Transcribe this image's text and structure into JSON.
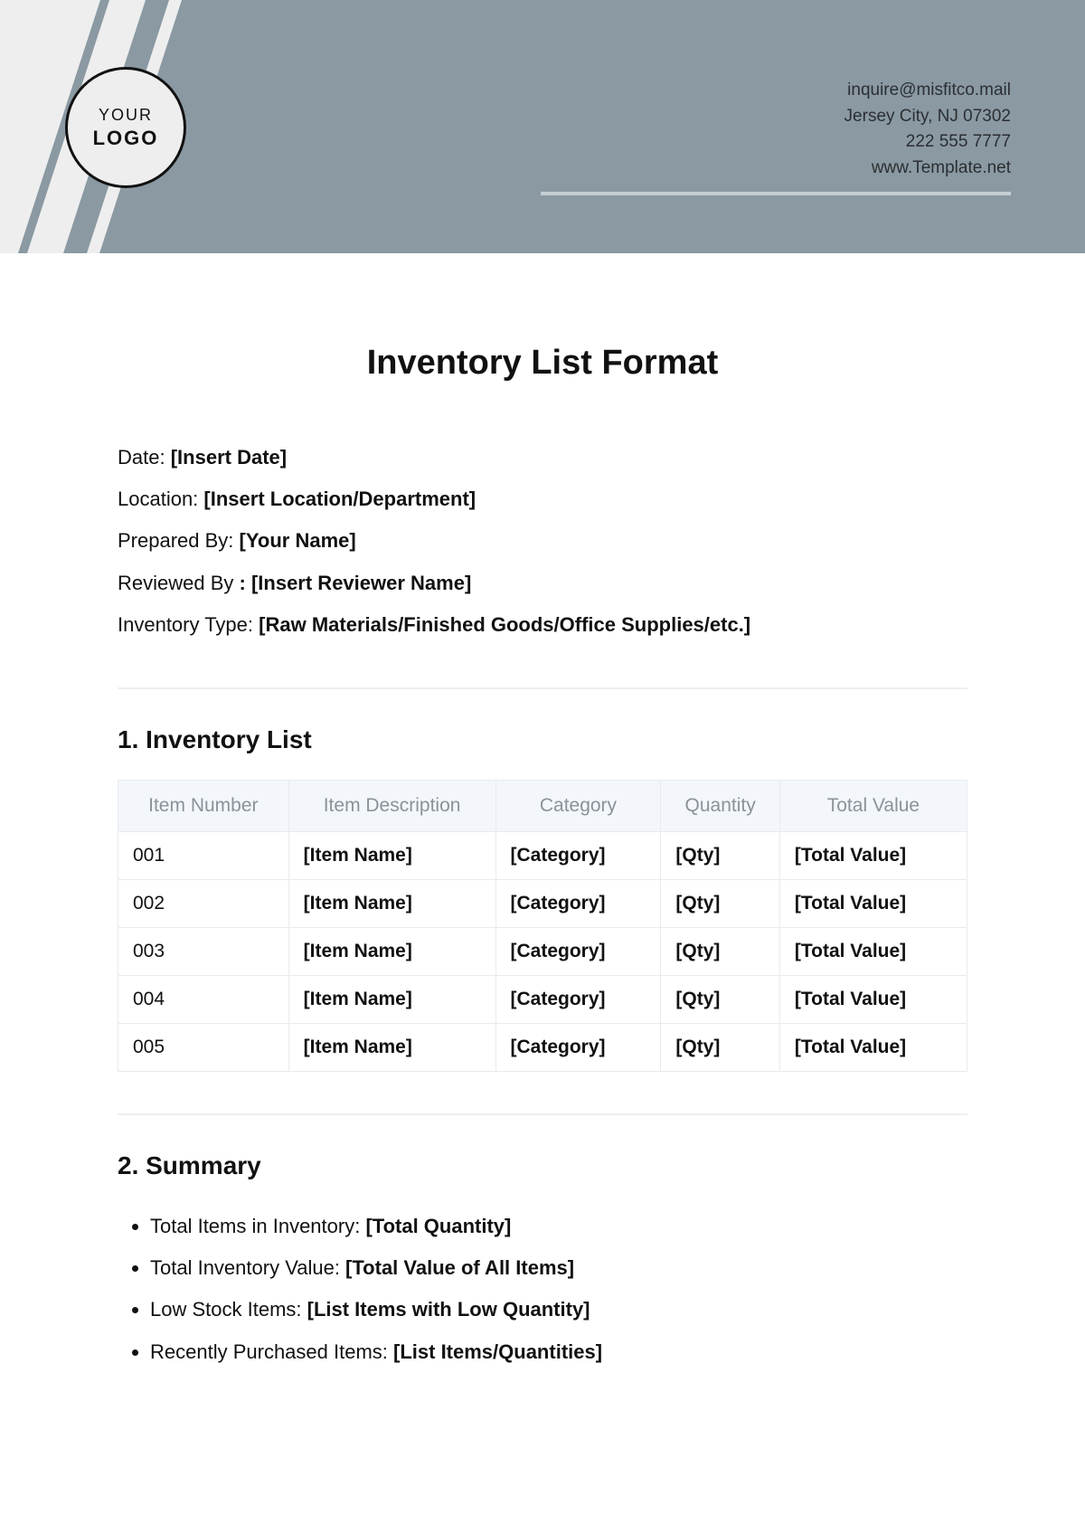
{
  "logo": {
    "line1": "YOUR",
    "line2": "LOGO"
  },
  "contact": {
    "email": "inquire@misfitco.mail",
    "address": "Jersey City, NJ 07302",
    "phone": "222 555 7777",
    "site": "www.Template.net"
  },
  "title": "Inventory List Format",
  "meta": {
    "date_label": "Date:",
    "date_value": "[Insert Date]",
    "location_label": "Location:",
    "location_value": "[Insert Location/Department]",
    "prepared_label": "Prepared By:",
    "prepared_value": "[Your Name]",
    "reviewed_label": "Reviewed By",
    "reviewed_value": ": [Insert Reviewer Name]",
    "type_label": "Inventory Type:",
    "type_value": "[Raw Materials/Finished Goods/Office Supplies/etc.]"
  },
  "sections": {
    "inventory_title": "1. Inventory List",
    "summary_title": "2. Summary"
  },
  "table": {
    "headers": {
      "c0": "Item Number",
      "c1": "Item Description",
      "c2": "Category",
      "c3": "Quantity",
      "c4": "Total Value"
    },
    "rows": [
      {
        "num": "001",
        "name": "[Item Name]",
        "cat": "[Category]",
        "qty": "[Qty]",
        "total": "[Total Value]"
      },
      {
        "num": "002",
        "name": "[Item Name]",
        "cat": "[Category]",
        "qty": "[Qty]",
        "total": "[Total Value]"
      },
      {
        "num": "003",
        "name": "[Item Name]",
        "cat": "[Category]",
        "qty": "[Qty]",
        "total": "[Total Value]"
      },
      {
        "num": "004",
        "name": "[Item Name]",
        "cat": "[Category]",
        "qty": "[Qty]",
        "total": "[Total Value]"
      },
      {
        "num": "005",
        "name": "[Item Name]",
        "cat": "[Category]",
        "qty": "[Qty]",
        "total": "[Total Value]"
      }
    ]
  },
  "summary": {
    "items": [
      {
        "label": "Total Items in Inventory: ",
        "value": "[Total Quantity]"
      },
      {
        "label": "Total Inventory Value: ",
        "value": "[Total Value of All Items]"
      },
      {
        "label": "Low Stock Items: ",
        "value": "[List Items with Low Quantity]"
      },
      {
        "label": "Recently Purchased Items: ",
        "value": "[List Items/Quantities]"
      }
    ]
  }
}
